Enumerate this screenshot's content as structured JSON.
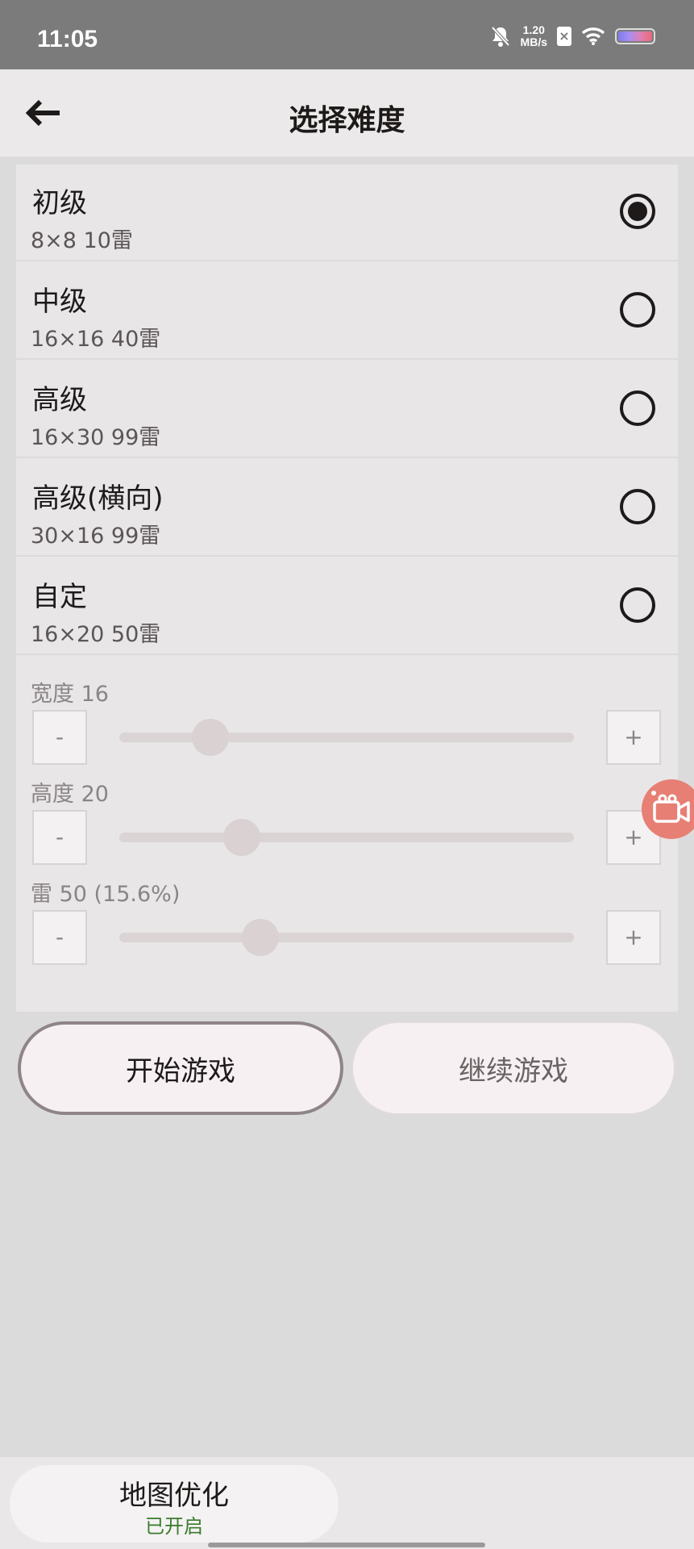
{
  "status_bar": {
    "time": "11:05",
    "net_speed_value": "1.20",
    "net_speed_unit": "MB/s",
    "sim_label": "×",
    "icons": [
      "mute-bell-icon",
      "sim-icon",
      "wifi-icon",
      "battery-icon"
    ]
  },
  "header": {
    "title": "选择难度",
    "back_icon": "arrow-left-icon"
  },
  "difficulties": [
    {
      "title": "初级",
      "subtitle": "8×8  10雷",
      "selected": true
    },
    {
      "title": "中级",
      "subtitle": "16×16  40雷",
      "selected": false
    },
    {
      "title": "高级",
      "subtitle": "16×30  99雷",
      "selected": false
    },
    {
      "title": "高级(横向)",
      "subtitle": "30×16  99雷",
      "selected": false
    },
    {
      "title": "自定",
      "subtitle": "16×20  50雷",
      "selected": false
    }
  ],
  "custom": {
    "width": {
      "label": "宽度  16",
      "value": 16,
      "fraction": 0.2,
      "minus": "-",
      "plus": "+"
    },
    "height": {
      "label": "高度  20",
      "value": 20,
      "fraction": 0.27,
      "minus": "-",
      "plus": "+"
    },
    "mines": {
      "label": "雷  50 (15.6%)",
      "value": 50,
      "fraction": 0.31,
      "minus": "-",
      "plus": "+"
    }
  },
  "actions": {
    "start": "开始游戏",
    "continue": "继续游戏"
  },
  "floating": {
    "icon": "screen-record-icon"
  },
  "bottom_card": {
    "title": "地图优化",
    "status": "已开启"
  },
  "colors": {
    "status_bar": "#7b7b7b",
    "background": "#dcdbdc",
    "record_button": "#e77f74",
    "enabled_green": "#3c7a2c"
  }
}
